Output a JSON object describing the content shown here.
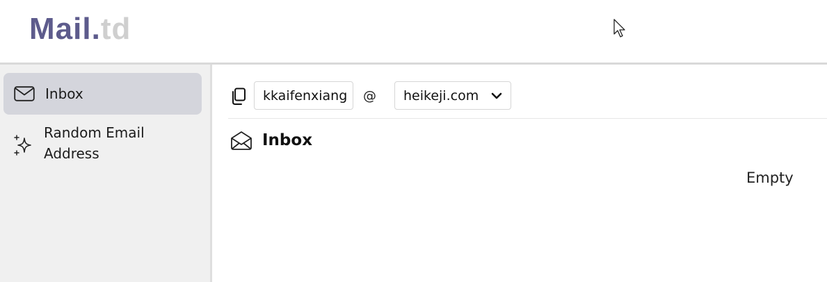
{
  "header": {
    "logo_main": "Mail",
    "logo_dot": ".",
    "logo_suffix": "td"
  },
  "sidebar": {
    "items": [
      {
        "label": "Inbox",
        "icon": "envelope-icon",
        "active": true
      },
      {
        "label": "Random Email Address",
        "icon": "sparkles-icon",
        "active": false
      }
    ]
  },
  "address": {
    "username": "kkaifenxiang",
    "at": "@",
    "domain": "heikeji.com"
  },
  "inbox": {
    "title": "Inbox",
    "empty_text": "Empty"
  },
  "colors": {
    "logo": "#5d5b8c",
    "sidebar_bg": "#f0f0f0",
    "active_item_bg": "#d4d5dc"
  }
}
